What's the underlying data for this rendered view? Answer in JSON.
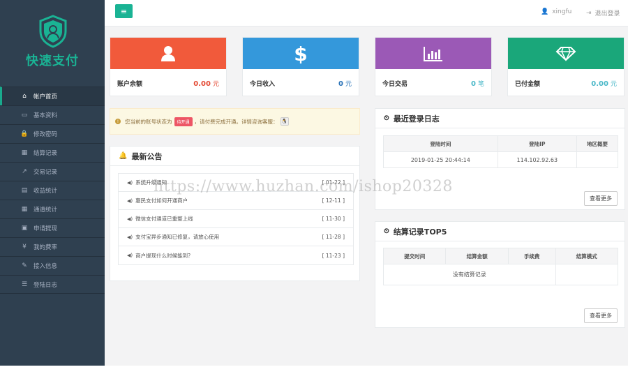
{
  "brand": {
    "name": "快速支付",
    "color": "#1ab394"
  },
  "sidebar": {
    "items": [
      {
        "label": "帐户首页",
        "icon": "home-icon",
        "glyph": "⌂",
        "active": true
      },
      {
        "label": "基本资料",
        "icon": "id-card-icon",
        "glyph": "▭"
      },
      {
        "label": "修改密码",
        "icon": "lock-icon",
        "glyph": "🔒"
      },
      {
        "label": "结算记录",
        "icon": "calendar-icon",
        "glyph": "▦"
      },
      {
        "label": "交易记录",
        "icon": "line-chart-icon",
        "glyph": "↗"
      },
      {
        "label": "收益统计",
        "icon": "inbox-icon",
        "glyph": "▤"
      },
      {
        "label": "通道统计",
        "icon": "calculator-icon",
        "glyph": "▦"
      },
      {
        "label": "申请提现",
        "icon": "calendar-check-icon",
        "glyph": "▣"
      },
      {
        "label": "我的费率",
        "icon": "yen-icon",
        "glyph": "¥"
      },
      {
        "label": "接入信息",
        "icon": "wrench-icon",
        "glyph": "✎"
      },
      {
        "label": "登陆日志",
        "icon": "list-icon",
        "glyph": "☰"
      }
    ]
  },
  "topbar": {
    "menu_glyph": "≡",
    "username": "xingfu",
    "logout_label": "退出登录",
    "user_glyph": "👤",
    "logout_glyph": "⇥"
  },
  "stats": [
    {
      "label": "账户余额",
      "value": "0.00",
      "unit": "元",
      "color": "#f15a3b",
      "value_color": "#e44b35",
      "icon": "user-icon"
    },
    {
      "label": "今日收入",
      "value": "0",
      "unit": "元",
      "color": "#3498db",
      "value_color": "#2a73b8",
      "icon": "dollar-icon"
    },
    {
      "label": "今日交易",
      "value": "0",
      "unit": "笔",
      "color": "#9b59b6",
      "value_color": "#4bb8c8",
      "icon": "bar-chart-icon"
    },
    {
      "label": "已付金额",
      "value": "0.00",
      "unit": "元",
      "color": "#1aa77a",
      "value_color": "#4bb8c8",
      "icon": "diamond-icon"
    }
  ],
  "alert": {
    "text_before": "您当前的账号状态为",
    "badge": "待开通",
    "text_after": "，请付费完成开通。详情咨询客服：",
    "warn_glyph": "!",
    "qq_glyph": "🐧"
  },
  "notices": {
    "title": "最新公告",
    "title_glyph": "🔔",
    "item_glyph": "◀)",
    "items": [
      {
        "text": "系统升级通知",
        "date": "[ 01-22 ]"
      },
      {
        "text": "惠民支付如何开通商户",
        "date": "[ 12-11 ]"
      },
      {
        "text": "微信支付通道已重整上线",
        "date": "[ 11-30 ]"
      },
      {
        "text": "支付宝异步通知已修复，请放心使用",
        "date": "[ 11-28 ]"
      },
      {
        "text": "商户提现什么时候能到？",
        "date": "[ 11-23 ]"
      }
    ]
  },
  "login_log": {
    "title": "最近登录日志",
    "title_glyph": "⏲",
    "headers": [
      "登陆时间",
      "登陆IP",
      "地区概要"
    ],
    "rows": [
      [
        "2019-01-25 20:44:14",
        "114.102.92.63",
        ""
      ]
    ],
    "more_label": "查看更多"
  },
  "settle": {
    "title": "结算记录TOP5",
    "title_glyph": "⏲",
    "headers": [
      "提交时间",
      "结算金额",
      "手续费",
      "结算模式"
    ],
    "empty": "没有结算记录",
    "more_label": "查看更多"
  },
  "watermark": "https://www.huzhan.com/ishop20328"
}
